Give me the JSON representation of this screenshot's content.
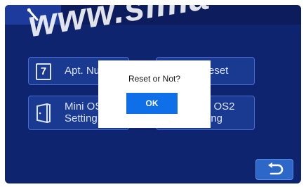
{
  "watermark": "www.sima",
  "tiles": {
    "apt_number": {
      "icon_digit": "7",
      "label": "Apt. Nun"
    },
    "reset": {
      "label": "eset"
    },
    "mini_os1": {
      "line1": "Mini OS",
      "line2": "Setting"
    },
    "mini_os2": {
      "line1": "i OS2",
      "line2": "ing"
    }
  },
  "dialog": {
    "title": "Reset or Not?",
    "ok_label": "OK"
  },
  "icons": {
    "tool_tab": "wrench-icon",
    "door": "door-icon",
    "back": "return-arrow-icon"
  },
  "colors": {
    "background": "#0f246e",
    "tile": "#1a3a92",
    "ok_button": "#0f6fe8",
    "back_button": "#2d67c7"
  }
}
